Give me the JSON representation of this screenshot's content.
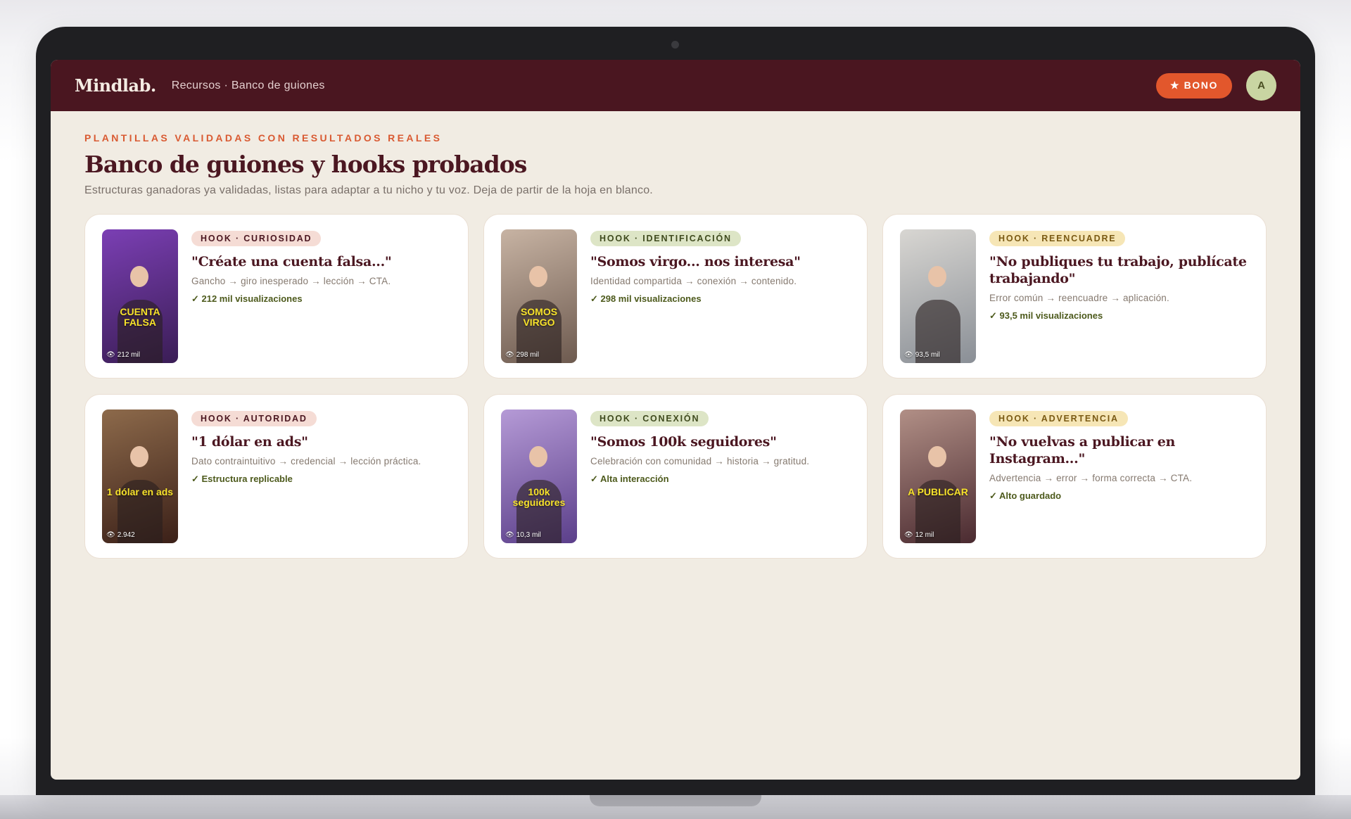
{
  "topbar": {
    "logo": "Mindlab.",
    "breadcrumb": "Recursos · Banco de guiones",
    "bono_label": "★ BONO",
    "avatar_initial": "A"
  },
  "header": {
    "eyebrow": "PLANTILLAS VALIDADAS CON RESULTADOS REALES",
    "title": "Banco de guiones y hooks probados",
    "subtitle": "Estructuras ganadoras ya validadas, listas para adaptar a tu nicho y tu voz. Deja de partir de la hoja en blanco."
  },
  "cards": [
    {
      "tag": "HOOK · CURIOSIDAD",
      "tag_style": "pink",
      "title": "\"Créate una cuenta falsa...\"",
      "structure": "Gancho → giro inesperado → lección → CTA.",
      "result": "✓ 212 mil visualizaciones",
      "thumb_caption": "CUENTA FALSA",
      "thumb_views": "212 mil",
      "thumb_colors": [
        "#3a1d55",
        "#7b3fb4"
      ]
    },
    {
      "tag": "HOOK · IDENTIFICACIÓN",
      "tag_style": "green",
      "title": "\"Somos virgo... nos interesa\"",
      "structure": "Identidad compartida → conexión → contenido.",
      "result": "✓ 298 mil visualizaciones",
      "thumb_caption": "SOMOS VIRGO",
      "thumb_views": "298 mil",
      "thumb_colors": [
        "#6d5a4f",
        "#c7b3a3"
      ]
    },
    {
      "tag": "HOOK · REENCUADRE",
      "tag_style": "yellow",
      "title": "\"No publiques tu trabajo, publícate trabajando\"",
      "structure": "Error común → reencuadre → aplicación.",
      "result": "✓ 93,5 mil visualizaciones",
      "thumb_caption": "",
      "thumb_views": "93,5 mil",
      "thumb_colors": [
        "#8a8f96",
        "#d8d6d2"
      ]
    },
    {
      "tag": "HOOK · AUTORIDAD",
      "tag_style": "pink",
      "title": "\"1 dólar en ads\"",
      "structure": "Dato contraintuitivo → credencial → lección práctica.",
      "result": "✓ Estructura replicable",
      "thumb_caption": "1 dólar en ads",
      "thumb_views": "2.942",
      "thumb_colors": [
        "#3b2018",
        "#8d6a4b"
      ]
    },
    {
      "tag": "HOOK · CONEXIÓN",
      "tag_style": "green",
      "title": "\"Somos 100k seguidores\"",
      "structure": "Celebración con comunidad → historia → gratitud.",
      "result": "✓ Alta interacción",
      "thumb_caption": "100k seguidores",
      "thumb_views": "10,3 mil",
      "thumb_colors": [
        "#5b3f8a",
        "#b59ad6"
      ]
    },
    {
      "tag": "HOOK · ADVERTENCIA",
      "tag_style": "yellow",
      "title": "\"No vuelvas a publicar en Instagram...\"",
      "structure": "Advertencia → error → forma correcta → CTA.",
      "result": "✓ Alto guardado",
      "thumb_caption": "A PUBLICAR",
      "thumb_views": "12 mil",
      "thumb_colors": [
        "#4a2a30",
        "#b18f86"
      ]
    }
  ]
}
